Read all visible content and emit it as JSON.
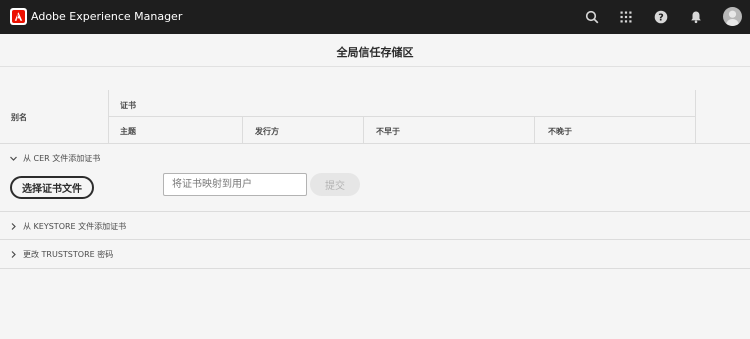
{
  "app": {
    "title": "Adobe Experience Manager"
  },
  "topbar_icons": [
    "search-icon",
    "apps-grid-icon",
    "help-icon",
    "bell-icon",
    "user-avatar"
  ],
  "page": {
    "title": "全局信任存储区"
  },
  "table": {
    "alias_header": "别名",
    "cert_group_header": "证书",
    "columns": [
      "主题",
      "发行方",
      "不早于",
      "不晚于"
    ]
  },
  "sections": {
    "cer": {
      "label": "从 CER 文件添加证书",
      "expanded": true,
      "select_button": "选择证书文件",
      "map_placeholder": "将证书映射到用户",
      "submit_button": "提交"
    },
    "keystore": {
      "label": "从 KEYSTORE 文件添加证书",
      "expanded": false
    },
    "truststore": {
      "label": "更改 TRUSTSTORE 密码",
      "expanded": false
    }
  },
  "colors": {
    "topbar": "#1e1e1e",
    "brand": "#eb1000",
    "background": "#f5f5f5"
  }
}
